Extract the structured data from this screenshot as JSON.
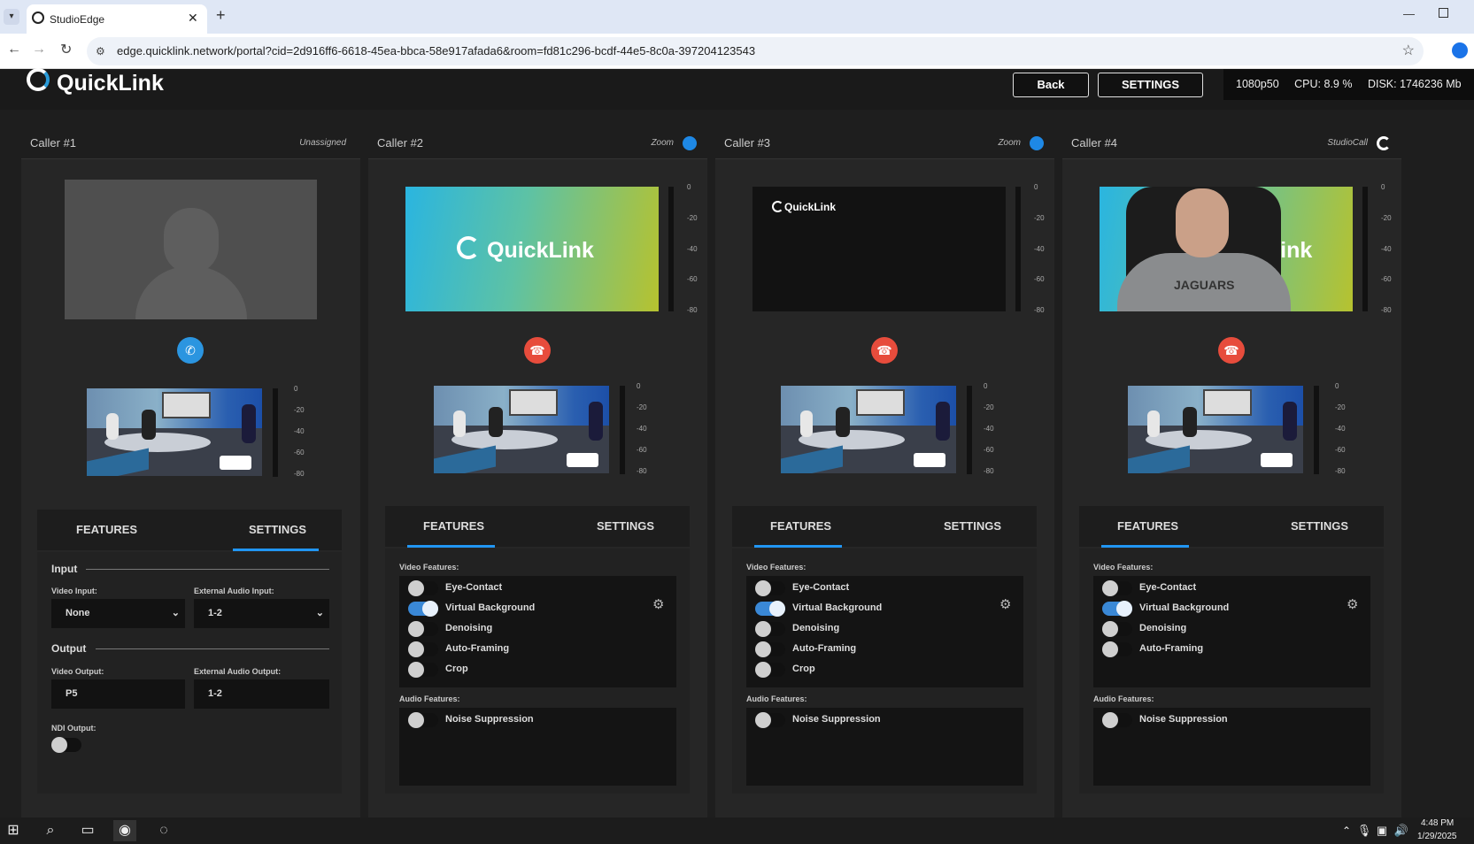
{
  "browser": {
    "tab_title": "StudioEdge",
    "url": "edge.quicklink.network/portal?cid=2d916ff6-6618-45ea-bbca-58e917afada6&room=fd81c296-bcdf-44e5-8c0a-397204123543"
  },
  "app": {
    "logo": "QuickLink",
    "back_label": "Back",
    "settings_label": "SETTINGS",
    "resolution": "1080p50",
    "cpu": "CPU: 8.9 %",
    "disk": "DISK: 1746236 Mb"
  },
  "meter_ticks": [
    "0",
    "-20",
    "-40",
    "-60",
    "-80"
  ],
  "tabs": {
    "features": "FEATURES",
    "settings": "SETTINGS"
  },
  "sections": {
    "video_features": "Video Features:",
    "audio_features": "Audio Features:"
  },
  "callers": [
    {
      "title": "Caller #1",
      "source": "Unassigned",
      "status": "idle",
      "active_tab": "settings",
      "settings": {
        "input_header": "Input",
        "video_input_label": "Video Input:",
        "video_input_value": "None",
        "ext_audio_input_label": "External Audio Input:",
        "ext_audio_input_value": "1-2",
        "output_header": "Output",
        "video_output_label": "Video Output:",
        "video_output_value": "P5",
        "ext_audio_output_label": "External Audio Output:",
        "ext_audio_output_value": "1-2",
        "ndi_output_label": "NDI Output:",
        "ndi_output_on": false
      }
    },
    {
      "title": "Caller #2",
      "source": "Zoom",
      "source_icon": "zoom-icon",
      "status": "connected",
      "preview_logo": "QuickLink",
      "active_tab": "features",
      "video_features": [
        {
          "label": "Eye-Contact",
          "on": false
        },
        {
          "label": "Virtual Background",
          "on": true
        },
        {
          "label": "Denoising",
          "on": false
        },
        {
          "label": "Auto-Framing",
          "on": false
        },
        {
          "label": "Crop",
          "on": false
        }
      ],
      "audio_features": [
        {
          "label": "Noise Suppression",
          "on": false
        }
      ]
    },
    {
      "title": "Caller #3",
      "source": "Zoom",
      "source_icon": "zoom-icon",
      "status": "connected",
      "preview_logo": "QuickLink",
      "active_tab": "features",
      "video_features": [
        {
          "label": "Eye-Contact",
          "on": false
        },
        {
          "label": "Virtual Background",
          "on": true
        },
        {
          "label": "Denoising",
          "on": false
        },
        {
          "label": "Auto-Framing",
          "on": false
        },
        {
          "label": "Crop",
          "on": false
        }
      ],
      "audio_features": [
        {
          "label": "Noise Suppression",
          "on": false
        }
      ]
    },
    {
      "title": "Caller #4",
      "source": "StudioCall",
      "source_icon": "studiocall-icon",
      "status": "connected",
      "preview_logo": "kLink",
      "hoodie_text": "JAGUARS",
      "active_tab": "features",
      "video_features": [
        {
          "label": "Eye-Contact",
          "on": false
        },
        {
          "label": "Virtual Background",
          "on": true
        },
        {
          "label": "Denoising",
          "on": false
        },
        {
          "label": "Auto-Framing",
          "on": false
        }
      ],
      "audio_features": [
        {
          "label": "Noise Suppression",
          "on": false
        }
      ]
    }
  ],
  "taskbar": {
    "time": "4:48 PM",
    "date": "1/29/2025"
  },
  "colors": {
    "accent": "#2196f3",
    "hangup": "#e74c3c",
    "call": "#2b95e0",
    "toggle_on": "#3a88d6"
  }
}
